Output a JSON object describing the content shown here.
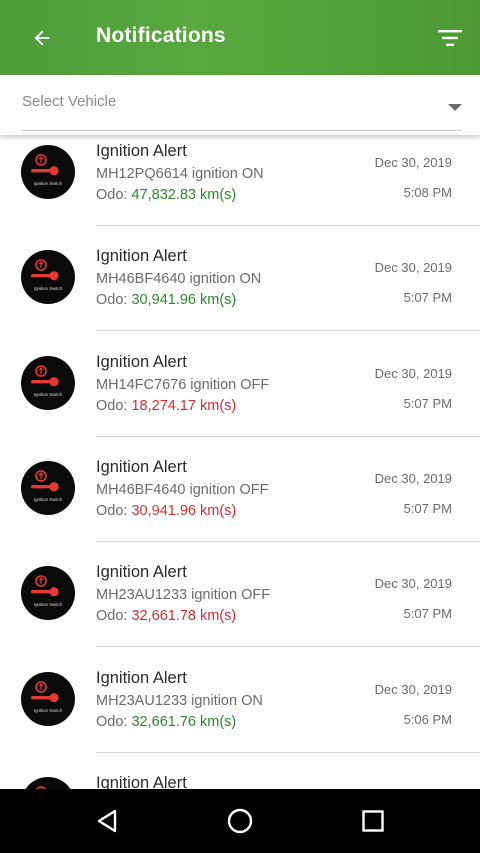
{
  "appbar": {
    "title": "Notifications",
    "back_icon": "arrow-back-icon",
    "filter_icon": "filter-icon",
    "color": "#58a83f"
  },
  "select": {
    "placeholder": "Select Vehicle"
  },
  "items": [
    {
      "title": "Ignition Alert",
      "vehicle_status": "MH12PQ6614 ignition ON",
      "odo_label": "Odo: ",
      "odo_value": "47,832.83 km(s)",
      "odo_color": "green",
      "date": "Dec 30, 2019",
      "time": "5:08 PM"
    },
    {
      "title": "Ignition Alert",
      "vehicle_status": "MH46BF4640 ignition ON",
      "odo_label": "Odo: ",
      "odo_value": "30,941.96 km(s)",
      "odo_color": "green",
      "date": "Dec 30, 2019",
      "time": "5:07 PM"
    },
    {
      "title": "Ignition Alert",
      "vehicle_status": "MH14FC7676 ignition OFF",
      "odo_label": "Odo: ",
      "odo_value": "18,274.17 km(s)",
      "odo_color": "red",
      "date": "Dec 30, 2019",
      "time": "5:07 PM"
    },
    {
      "title": "Ignition Alert",
      "vehicle_status": "MH46BF4640 ignition OFF",
      "odo_label": "Odo: ",
      "odo_value": "30,941.96 km(s)",
      "odo_color": "red",
      "date": "Dec 30, 2019",
      "time": "5:07 PM"
    },
    {
      "title": "Ignition Alert",
      "vehicle_status": "MH23AU1233 ignition OFF",
      "odo_label": "Odo: ",
      "odo_value": "32,661.78 km(s)",
      "odo_color": "red",
      "date": "Dec 30, 2019",
      "time": "5:07 PM"
    },
    {
      "title": "Ignition Alert",
      "vehicle_status": "MH23AU1233 ignition ON",
      "odo_label": "Odo: ",
      "odo_value": "32,661.76 km(s)",
      "odo_color": "green",
      "date": "Dec 30, 2019",
      "time": "5:06 PM"
    },
    {
      "title": "Ignition Alert",
      "vehicle_status": "",
      "odo_label": "",
      "odo_value": "",
      "odo_color": "green",
      "date": "",
      "time": ""
    }
  ],
  "avatar_label": "Ignition Switch",
  "navbar": {
    "back_icon": "nav-back-icon",
    "home_icon": "nav-home-icon",
    "recents_icon": "nav-recents-icon"
  }
}
